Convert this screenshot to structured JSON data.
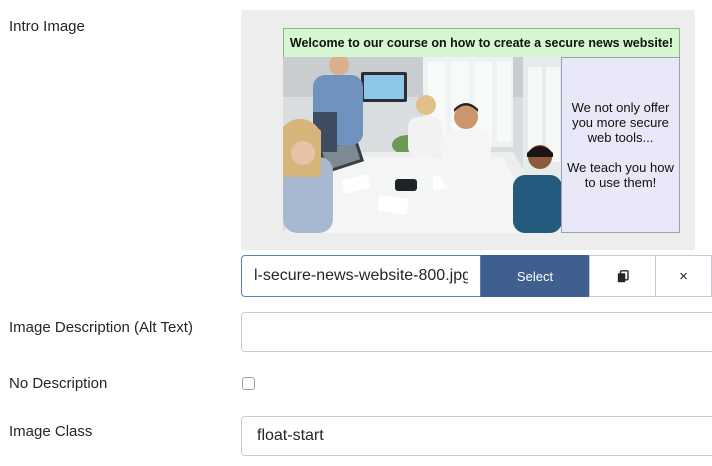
{
  "intro_image": {
    "label": "Intro Image",
    "banner_text": "Welcome to our course on how to create a secure news website!",
    "side_text": [
      "We not only offer you more secure web tools...",
      "We teach you how to use them!"
    ],
    "filename_value": "l-secure-news-website-800.jpg",
    "select_label": "Select",
    "copy_icon": "copy-icon",
    "clear_glyph": "×"
  },
  "alt_text": {
    "label": "Image Description (Alt Text)",
    "value": ""
  },
  "no_description": {
    "label": "No Description",
    "checked": false
  },
  "image_class": {
    "label": "Image Class",
    "value": "float-start"
  },
  "colors": {
    "select_button": "#3f5f8f",
    "banner_background": "#d6f5d1",
    "side_panel_background": "#e8e8f8",
    "input_border": "#c8ccd0"
  }
}
